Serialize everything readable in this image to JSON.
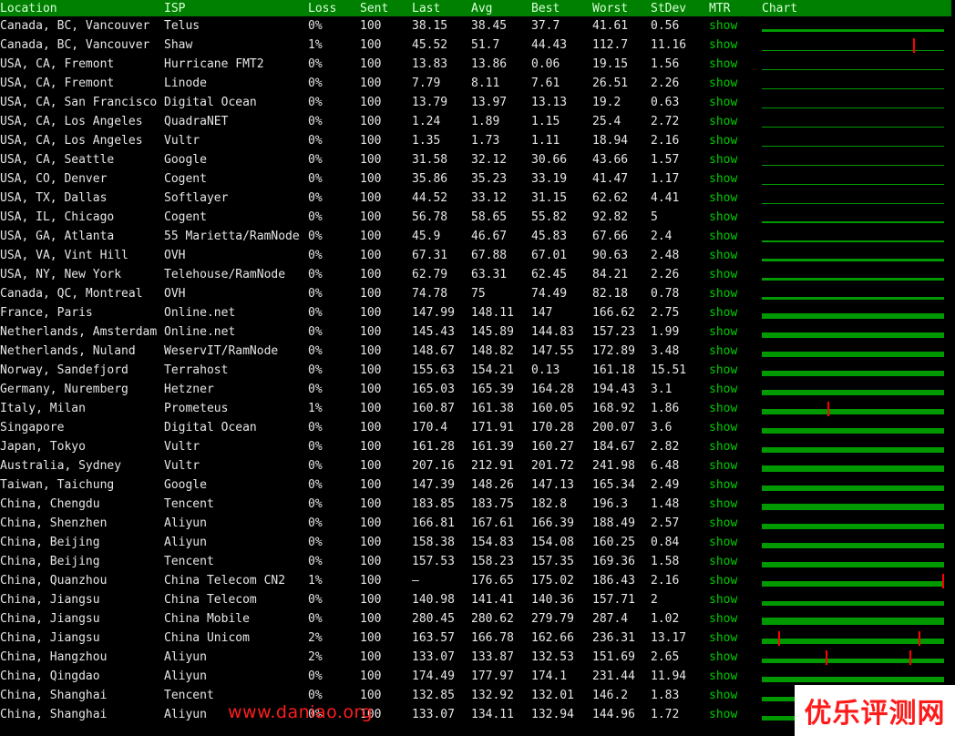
{
  "headers": {
    "location": "Location",
    "isp": "ISP",
    "loss": "Loss",
    "sent": "Sent",
    "last": "Last",
    "avg": "Avg",
    "best": "Best",
    "worst": "Worst",
    "stdev": "StDev",
    "mtr": "MTR",
    "chart": "Chart"
  },
  "mtr_label": "show",
  "colors": {
    "header_bg": "#008000",
    "chart_fill": "#009900",
    "spike": "#ff0000"
  },
  "rows": [
    {
      "location": "Canada, BC, Vancouver",
      "isp": "Telus",
      "loss": "0%",
      "sent": "100",
      "last": "38.15",
      "avg": "38.45",
      "best": "37.7",
      "worst": "41.61",
      "stdev": "0.56",
      "fill": 0.3
    },
    {
      "location": "Canada, BC, Vancouver",
      "isp": "Shaw",
      "loss": "1%",
      "sent": "100",
      "last": "45.52",
      "avg": "51.7",
      "best": "44.43",
      "worst": "112.7",
      "stdev": "11.16",
      "fill": 0.1
    },
    {
      "location": "USA, CA, Fremont",
      "isp": "Hurricane FMT2",
      "loss": "0%",
      "sent": "100",
      "last": "13.83",
      "avg": "13.86",
      "best": "0.06",
      "worst": "19.15",
      "stdev": "1.56",
      "fill": 0.05
    },
    {
      "location": "USA, CA, Fremont",
      "isp": "Linode",
      "loss": "0%",
      "sent": "100",
      "last": "7.79",
      "avg": "8.11",
      "best": "7.61",
      "worst": "26.51",
      "stdev": "2.26",
      "fill": 0.05
    },
    {
      "location": "USA, CA, San Francisco",
      "isp": "Digital Ocean",
      "loss": "0%",
      "sent": "100",
      "last": "13.79",
      "avg": "13.97",
      "best": "13.13",
      "worst": "19.2",
      "stdev": "0.63",
      "fill": 0.05
    },
    {
      "location": "USA, CA, Los Angeles",
      "isp": "QuadraNET",
      "loss": "0%",
      "sent": "100",
      "last": "1.24",
      "avg": "1.89",
      "best": "1.15",
      "worst": "25.4",
      "stdev": "2.72",
      "fill": 0.04
    },
    {
      "location": "USA, CA, Los Angeles",
      "isp": "Vultr",
      "loss": "0%",
      "sent": "100",
      "last": "1.35",
      "avg": "1.73",
      "best": "1.11",
      "worst": "18.94",
      "stdev": "2.16",
      "fill": 0.04
    },
    {
      "location": "USA, CA, Seattle",
      "isp": "Google",
      "loss": "0%",
      "sent": "100",
      "last": "31.58",
      "avg": "32.12",
      "best": "30.66",
      "worst": "43.66",
      "stdev": "1.57",
      "fill": 0.1
    },
    {
      "location": "USA, CO, Denver",
      "isp": "Cogent",
      "loss": "0%",
      "sent": "100",
      "last": "35.86",
      "avg": "35.23",
      "best": "33.19",
      "worst": "41.47",
      "stdev": "1.17",
      "fill": 0.1
    },
    {
      "location": "USA, TX, Dallas",
      "isp": "Softlayer",
      "loss": "0%",
      "sent": "100",
      "last": "44.52",
      "avg": "33.12",
      "best": "31.15",
      "worst": "62.62",
      "stdev": "4.41",
      "fill": 0.12
    },
    {
      "location": "USA, IL, Chicago",
      "isp": "Cogent",
      "loss": "0%",
      "sent": "100",
      "last": "56.78",
      "avg": "58.65",
      "best": "55.82",
      "worst": "92.82",
      "stdev": "5",
      "fill": 0.2
    },
    {
      "location": "USA, GA, Atlanta",
      "isp": "55 Marietta/RamNode",
      "loss": "0%",
      "sent": "100",
      "last": "45.9",
      "avg": "46.67",
      "best": "45.83",
      "worst": "67.66",
      "stdev": "2.4",
      "fill": 0.22
    },
    {
      "location": "USA, VA, Vint Hill",
      "isp": "OVH",
      "loss": "0%",
      "sent": "100",
      "last": "67.31",
      "avg": "67.88",
      "best": "67.01",
      "worst": "90.63",
      "stdev": "2.48",
      "fill": 0.25
    },
    {
      "location": "USA, NY, New York",
      "isp": "Telehouse/RamNode",
      "loss": "0%",
      "sent": "100",
      "last": "62.79",
      "avg": "63.31",
      "best": "62.45",
      "worst": "84.21",
      "stdev": "2.26",
      "fill": 0.25
    },
    {
      "location": "Canada, QC, Montreal",
      "isp": "OVH",
      "loss": "0%",
      "sent": "100",
      "last": "74.78",
      "avg": "75",
      "best": "74.49",
      "worst": "82.18",
      "stdev": "0.78",
      "fill": 0.3
    },
    {
      "location": "France, Paris",
      "isp": "Online.net",
      "loss": "0%",
      "sent": "100",
      "last": "147.99",
      "avg": "148.11",
      "best": "147",
      "worst": "166.62",
      "stdev": "2.75",
      "fill": 0.55
    },
    {
      "location": "Netherlands, Amsterdam",
      "isp": "Online.net",
      "loss": "0%",
      "sent": "100",
      "last": "145.43",
      "avg": "145.89",
      "best": "144.83",
      "worst": "157.23",
      "stdev": "1.99",
      "fill": 0.55
    },
    {
      "location": "Netherlands, Nuland",
      "isp": "WeservIT/RamNode",
      "loss": "0%",
      "sent": "100",
      "last": "148.67",
      "avg": "148.82",
      "best": "147.55",
      "worst": "172.89",
      "stdev": "3.48",
      "fill": 0.55
    },
    {
      "location": "Norway, Sandefjord",
      "isp": "Terrahost",
      "loss": "0%",
      "sent": "100",
      "last": "155.63",
      "avg": "154.21",
      "best": "0.13",
      "worst": "161.18",
      "stdev": "15.51",
      "fill": 0.6
    },
    {
      "location": "Germany, Nuremberg",
      "isp": "Hetzner",
      "loss": "0%",
      "sent": "100",
      "last": "165.03",
      "avg": "165.39",
      "best": "164.28",
      "worst": "194.43",
      "stdev": "3.1",
      "fill": 0.6
    },
    {
      "location": "Italy, Milan",
      "isp": "Prometeus",
      "loss": "1%",
      "sent": "100",
      "last": "160.87",
      "avg": "161.38",
      "best": "160.05",
      "worst": "168.92",
      "stdev": "1.86",
      "fill": 0.6
    },
    {
      "location": "Singapore",
      "isp": "Digital Ocean",
      "loss": "0%",
      "sent": "100",
      "last": "170.4",
      "avg": "171.91",
      "best": "170.28",
      "worst": "200.07",
      "stdev": "3.6",
      "fill": 0.6
    },
    {
      "location": "Japan, Tokyo",
      "isp": "Vultr",
      "loss": "0%",
      "sent": "100",
      "last": "161.28",
      "avg": "161.39",
      "best": "160.27",
      "worst": "184.67",
      "stdev": "2.82",
      "fill": 0.6
    },
    {
      "location": "Australia, Sydney",
      "isp": "Vultr",
      "loss": "0%",
      "sent": "100",
      "last": "207.16",
      "avg": "212.91",
      "best": "201.72",
      "worst": "241.98",
      "stdev": "6.48",
      "fill": 0.7
    },
    {
      "location": "Taiwan, Taichung",
      "isp": "Google",
      "loss": "0%",
      "sent": "100",
      "last": "147.39",
      "avg": "148.26",
      "best": "147.13",
      "worst": "165.34",
      "stdev": "2.49",
      "fill": 0.55
    },
    {
      "location": "China, Chengdu",
      "isp": "Tencent",
      "loss": "0%",
      "sent": "100",
      "last": "183.85",
      "avg": "183.75",
      "best": "182.8",
      "worst": "196.3",
      "stdev": "1.48",
      "fill": 0.65
    },
    {
      "location": "China, Shenzhen",
      "isp": "Aliyun",
      "loss": "0%",
      "sent": "100",
      "last": "166.81",
      "avg": "167.61",
      "best": "166.39",
      "worst": "188.49",
      "stdev": "2.57",
      "fill": 0.6
    },
    {
      "location": "China, Beijing",
      "isp": "Aliyun",
      "loss": "0%",
      "sent": "100",
      "last": "158.38",
      "avg": "154.83",
      "best": "154.08",
      "worst": "160.25",
      "stdev": "0.84",
      "fill": 0.58
    },
    {
      "location": "China, Beijing",
      "isp": "Tencent",
      "loss": "0%",
      "sent": "100",
      "last": "157.53",
      "avg": "158.23",
      "best": "157.35",
      "worst": "169.36",
      "stdev": "1.58",
      "fill": 0.58
    },
    {
      "location": "China, Quanzhou",
      "isp": "China Telecom CN2",
      "loss": "1%",
      "sent": "100",
      "last": "–",
      "avg": "176.65",
      "best": "175.02",
      "worst": "186.43",
      "stdev": "2.16",
      "fill": 0.62
    },
    {
      "location": "China, Jiangsu",
      "isp": "China Telecom",
      "loss": "0%",
      "sent": "100",
      "last": "140.98",
      "avg": "141.41",
      "best": "140.36",
      "worst": "157.71",
      "stdev": "2",
      "fill": 0.52
    },
    {
      "location": "China, Jiangsu",
      "isp": "China Mobile",
      "loss": "0%",
      "sent": "100",
      "last": "280.45",
      "avg": "280.62",
      "best": "279.79",
      "worst": "287.4",
      "stdev": "1.02",
      "fill": 0.8
    },
    {
      "location": "China, Jiangsu",
      "isp": "China Unicom",
      "loss": "2%",
      "sent": "100",
      "last": "163.57",
      "avg": "166.78",
      "best": "162.66",
      "worst": "236.31",
      "stdev": "13.17",
      "fill": 0.6
    },
    {
      "location": "China, Hangzhou",
      "isp": "Aliyun",
      "loss": "2%",
      "sent": "100",
      "last": "133.07",
      "avg": "133.87",
      "best": "132.53",
      "worst": "151.69",
      "stdev": "2.65",
      "fill": 0.5
    },
    {
      "location": "China, Qingdao",
      "isp": "Aliyun",
      "loss": "0%",
      "sent": "100",
      "last": "174.49",
      "avg": "177.97",
      "best": "174.1",
      "worst": "231.44",
      "stdev": "11.94",
      "fill": 0.62
    },
    {
      "location": "China, Shanghai",
      "isp": "Tencent",
      "loss": "0%",
      "sent": "100",
      "last": "132.85",
      "avg": "132.92",
      "best": "132.01",
      "worst": "146.2",
      "stdev": "1.83",
      "fill": 0.5
    },
    {
      "location": "China, Shanghai",
      "isp": "Aliyun",
      "loss": "0%",
      "sent": "100",
      "last": "133.07",
      "avg": "134.11",
      "best": "132.94",
      "worst": "144.96",
      "stdev": "1.72",
      "fill": 0.5
    }
  ],
  "spikes": {
    "1": [
      0.83
    ],
    "20": [
      0.36
    ],
    "29": [
      0.995
    ],
    "32": [
      0.09,
      0.86
    ],
    "33": [
      0.35,
      0.81
    ]
  },
  "watermark_left": "www.daniao.org",
  "watermark_right": "优乐评测网"
}
